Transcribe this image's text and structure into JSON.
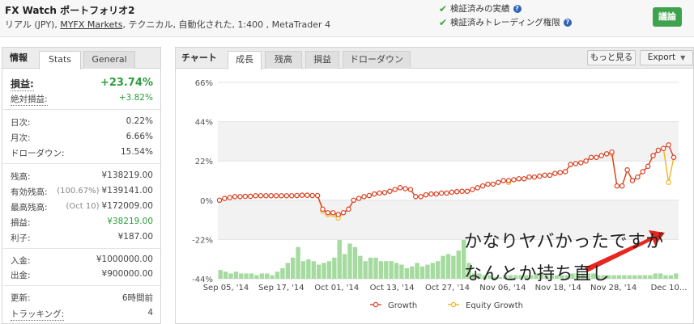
{
  "header": {
    "title": "FX Watch ポートフォリオ2",
    "sub_prefix": "リアル (JPY), ",
    "broker": "MYFX Markets",
    "sub_suffix": ", テクニカル, 自動化された, 1:400 , MetaTrader 4",
    "verify_track": "検証済みの実績",
    "verify_trading": "検証済みトレーディング権限",
    "discuss_label": "議論"
  },
  "left_tabs": {
    "info": "情報",
    "stats": "Stats",
    "general": "General"
  },
  "stats": {
    "gain_label": "損益:",
    "gain_value": "+23.74%",
    "abs_gain_label": "絶対損益:",
    "abs_gain_value": "+3.82%",
    "daily_label": "日次:",
    "daily_value": "0.22%",
    "monthly_label": "月次:",
    "monthly_value": "6.66%",
    "drawdown_label": "ドローダウン:",
    "drawdown_value": "15.54%",
    "balance_label": "残高:",
    "balance_value": "¥138219.00",
    "equity_label": "有効残高:",
    "equity_pre": "(100.67%)",
    "equity_value": "¥139141.00",
    "highest_label": "最高残高:",
    "highest_pre": "(Oct 10)",
    "highest_value": "¥172009.00",
    "profit_label": "損益:",
    "profit_value": "¥38219.00",
    "interest_label": "利子:",
    "interest_value": "¥187.00",
    "deposit_label": "入金:",
    "deposit_value": "¥1000000.00",
    "withdraw_label": "出金:",
    "withdraw_value": "¥900000.00",
    "updated_label": "更新:",
    "updated_value": "6時間前",
    "tracking_label": "トラッキング:",
    "tracking_value": "4"
  },
  "right_tabs": {
    "chart": "チャート",
    "growth": "成長",
    "balance": "残高",
    "profit": "損益",
    "drawdown": "ドローダウン",
    "more": "もっと見る",
    "export": "Export"
  },
  "annotation": {
    "line1": "かなりヤバかったですが",
    "line2": "なんとか持ち直し"
  },
  "colors": {
    "growth": "#d9412b",
    "equity": "#f2b320",
    "bars": "#a6dba0",
    "accent_green": "#2e9e3f",
    "arrow": "#e8261e"
  },
  "chart_data": {
    "type": "line",
    "y_ticks": [
      "66%",
      "44%",
      "22%",
      "0%",
      "-22%",
      "-44%"
    ],
    "ylim": [
      -44,
      66
    ],
    "x_ticks": [
      "Sep 05, '14",
      "Sep 17, '14",
      "Oct 01, '14",
      "Oct 13, '14",
      "Oct 27, '14",
      "Nov 06, '14",
      "Nov 18, '14",
      "Nov 28, '14",
      "Dec 10..."
    ],
    "series": [
      {
        "name": "Growth",
        "values": [
          0,
          1,
          1.5,
          2,
          2,
          2.2,
          2.2,
          2.5,
          2.5,
          2.5,
          2.5,
          2.5,
          2.5,
          2.5,
          2.5,
          2.6,
          2.8,
          2.8,
          2.6,
          2.6,
          -5,
          -7,
          -7,
          -8,
          -7,
          -5,
          0,
          1,
          2,
          2.6,
          3.5,
          4,
          4.3,
          5,
          6,
          7,
          6.5,
          6,
          2,
          2,
          3,
          3.5,
          3.5,
          4,
          4,
          4.5,
          4.8,
          5,
          5,
          6,
          7,
          8,
          9,
          9,
          10,
          11,
          11,
          11.5,
          12,
          12,
          13,
          13,
          13.5,
          14,
          14,
          15,
          15.5,
          16,
          20,
          20.5,
          21,
          22,
          24,
          24,
          25,
          26,
          27,
          8,
          8,
          17,
          11,
          13,
          16,
          19,
          25,
          28,
          29,
          31,
          24
        ]
      },
      {
        "name": "Equity Growth",
        "values": [
          0,
          1,
          1.5,
          2,
          2,
          2.2,
          2.2,
          2.5,
          2.5,
          2.5,
          2.5,
          2.5,
          2.5,
          2.5,
          2.5,
          2.6,
          2.8,
          2.8,
          2.6,
          2.6,
          -6,
          -8,
          -8,
          -10,
          -7,
          -5,
          0,
          1,
          2,
          2.6,
          3.5,
          4,
          4.3,
          5,
          6,
          7,
          6.5,
          6,
          2,
          2,
          3,
          3.5,
          3.5,
          4,
          4,
          4.5,
          4.8,
          5,
          5,
          6,
          7,
          8,
          9,
          9,
          10,
          11,
          10,
          11.5,
          12,
          12,
          13,
          13,
          13.5,
          14,
          14,
          15,
          15.5,
          16,
          20,
          20.5,
          21,
          22,
          24,
          24,
          25,
          26,
          26,
          8,
          8,
          17,
          11,
          13,
          16,
          19,
          25,
          28,
          29,
          10,
          24
        ]
      }
    ],
    "bars": [
      5,
      4,
      3,
      4,
      3,
      3,
      3,
      2,
      3,
      3,
      2,
      4,
      6,
      9,
      12,
      18,
      10,
      11,
      10,
      8,
      9,
      10,
      12,
      22,
      14,
      20,
      18,
      13,
      10,
      12,
      12,
      10,
      10,
      10,
      9,
      8,
      6,
      7,
      9,
      7,
      8,
      9,
      10,
      13,
      14,
      13,
      16,
      22,
      9,
      3,
      3,
      2,
      2,
      1,
      1,
      2,
      2,
      2,
      2,
      2,
      2,
      3,
      3,
      2,
      2,
      2,
      2,
      2,
      3,
      3,
      3,
      3,
      3,
      2,
      2,
      2,
      2,
      2,
      2,
      2,
      2,
      2,
      2,
      2,
      3,
      3,
      2,
      2,
      3
    ],
    "legend": [
      "Growth",
      "Equity Growth"
    ],
    "legend_position": "bottom"
  }
}
